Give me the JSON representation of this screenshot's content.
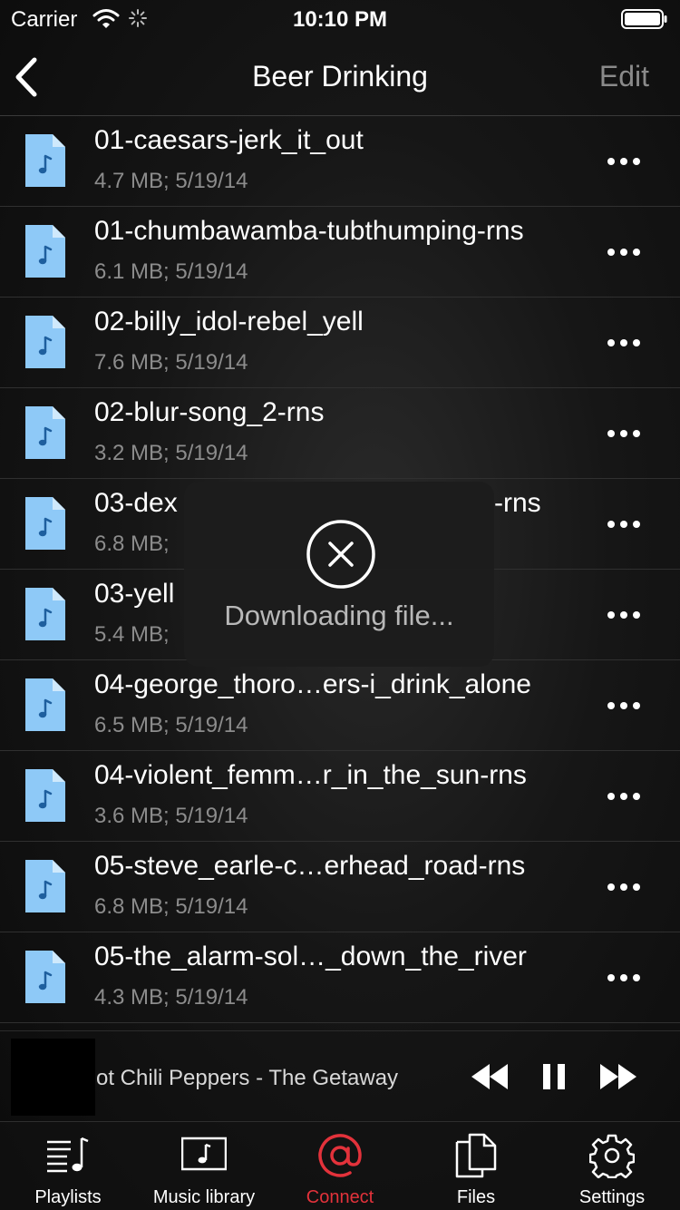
{
  "status_bar": {
    "carrier": "Carrier",
    "time": "10:10 PM"
  },
  "nav": {
    "title": "Beer Drinking",
    "edit_label": "Edit"
  },
  "files": [
    {
      "name": "01-caesars-jerk_it_out",
      "meta": "4.7 MB; 5/19/14"
    },
    {
      "name": "01-chumbawamba-tubthumping-rns",
      "meta": "6.1 MB; 5/19/14"
    },
    {
      "name": "02-billy_idol-rebel_yell",
      "meta": "7.6 MB; 5/19/14"
    },
    {
      "name": "02-blur-song_2-rns",
      "meta": "3.2 MB; 5/19/14"
    },
    {
      "name": "03-dex",
      "name_tail": "-rns",
      "meta": "6.8 MB;"
    },
    {
      "name": "03-yell",
      "meta": "5.4 MB;"
    },
    {
      "name": "04-george_thoro…ers-i_drink_alone",
      "meta": "6.5 MB; 5/19/14"
    },
    {
      "name": "04-violent_femm…r_in_the_sun-rns",
      "meta": "3.6 MB; 5/19/14"
    },
    {
      "name": "05-steve_earle-c…erhead_road-rns",
      "meta": "6.8 MB; 5/19/14"
    },
    {
      "name": "05-the_alarm-sol…_down_the_river",
      "meta": "4.3 MB; 5/19/14"
    }
  ],
  "hud": {
    "message": "Downloading file...",
    "icon": "close-circle-icon"
  },
  "now_playing": {
    "title": "ot Chili Peppers - The Getaway"
  },
  "tabs": [
    {
      "label": "Playlists",
      "icon": "playlists-icon",
      "active": false
    },
    {
      "label": "Music library",
      "icon": "music-library-icon",
      "active": false
    },
    {
      "label": "Connect",
      "icon": "at-sign-icon",
      "active": true
    },
    {
      "label": "Files",
      "icon": "files-icon",
      "active": false
    },
    {
      "label": "Settings",
      "icon": "gear-icon",
      "active": false
    }
  ],
  "colors": {
    "accent": "#e3323b",
    "file_icon": "#8ec9f7",
    "secondary_text": "#8c8c8c"
  }
}
